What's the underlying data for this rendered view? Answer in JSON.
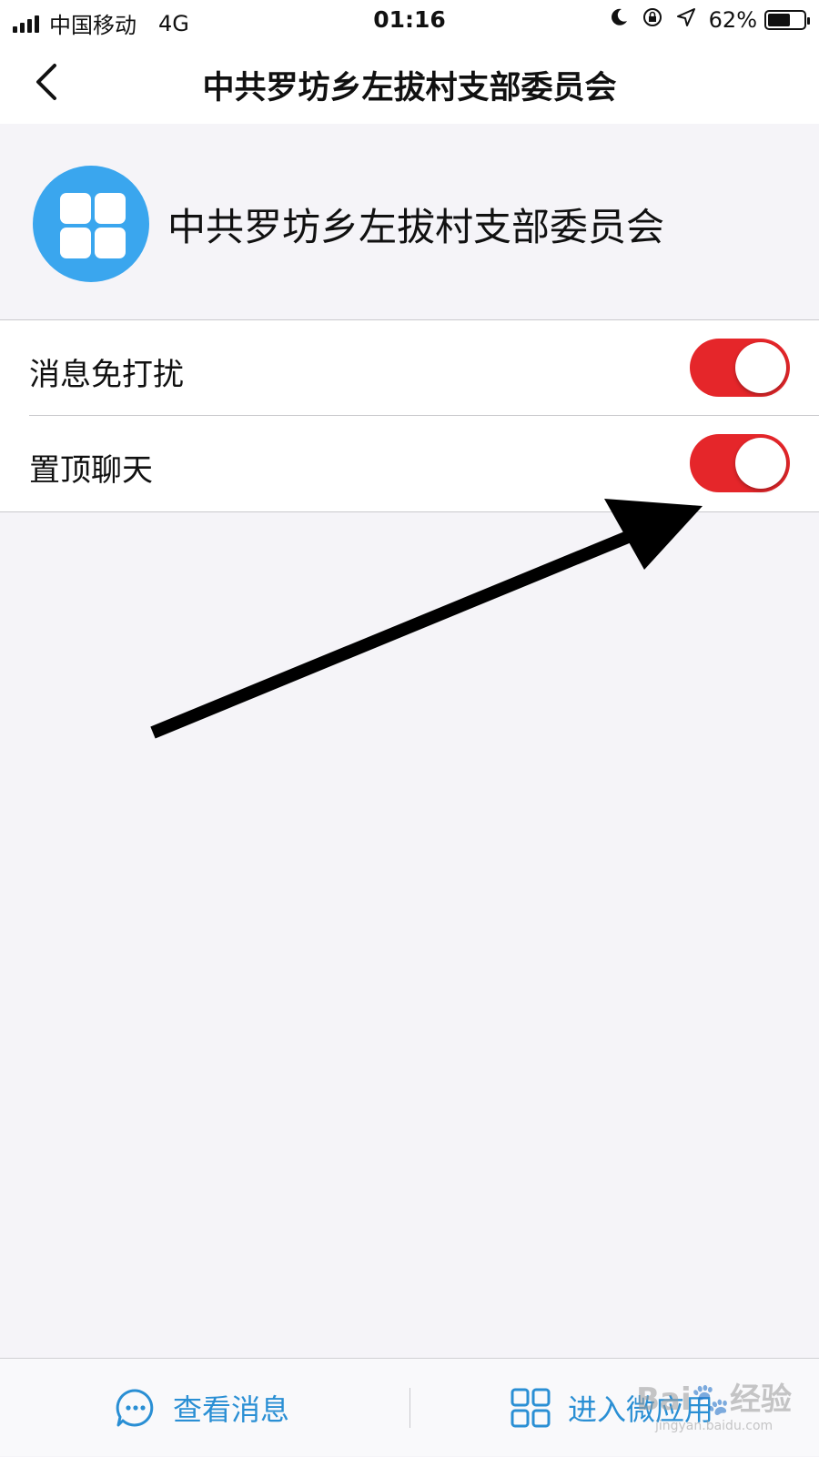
{
  "status_bar": {
    "carrier": "中国移动",
    "network": "4G",
    "time": "01:16",
    "battery_percent": "62%",
    "battery_level": 0.62,
    "icons": [
      "signal-icon",
      "moon-icon",
      "rotation-lock-icon",
      "location-icon",
      "battery-icon"
    ]
  },
  "nav": {
    "title": "中共罗坊乡左拔村支部委员会",
    "back_icon": "chevron-left-icon"
  },
  "profile": {
    "name": "中共罗坊乡左拔村支部委员会",
    "avatar_icon": "grid-apps-icon",
    "avatar_color": "#3aa6ee"
  },
  "settings": [
    {
      "label": "消息免打扰",
      "enabled": true
    },
    {
      "label": "置顶聊天",
      "enabled": true
    }
  ],
  "toggle_on_color": "#e5262a",
  "bottom_bar": {
    "view_messages_label": "查看消息",
    "enter_app_label": "进入微应用",
    "accent_color": "#2a8fd4"
  },
  "watermark": {
    "brand": "Bai🐾经验",
    "url": "jingyan.baidu.com"
  }
}
